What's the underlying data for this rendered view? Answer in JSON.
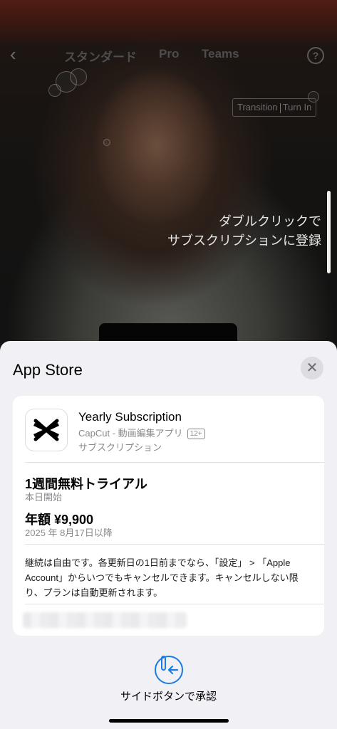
{
  "nav": {
    "back_icon": "chevron-left-icon",
    "tabs": [
      "スタンダード",
      "Pro",
      "Teams"
    ],
    "help_icon": "question-circle-icon"
  },
  "effect_tag": {
    "left": "Transition",
    "right": "Turn In"
  },
  "hint": {
    "line1": "ダブルクリックで",
    "line2": "サブスクリプションに登録"
  },
  "sheet": {
    "title": "App Store",
    "close_icon": "close-icon",
    "product": {
      "name": "Yearly Subscription",
      "app": "CapCut - 動画編集アプリ",
      "age_rating": "12+",
      "kind": "サブスクリプション"
    },
    "trial": {
      "title": "1週間無料トライアル",
      "start": "本日開始"
    },
    "price": {
      "amount": "年額 ¥9,900",
      "from": "2025 年 8月17日以降"
    },
    "terms": "継続は自由です。各更新日の1日前までなら、「設定」 > 「Apple Account」からいつでもキャンセルできます。キャンセルしない限り、プランは自動更新されます。",
    "confirm_label": "サイドボタンで承認"
  },
  "colors": {
    "accent": "#1a7ce3",
    "sheet_bg": "#f0f0f5",
    "card_bg": "#ffffff"
  }
}
